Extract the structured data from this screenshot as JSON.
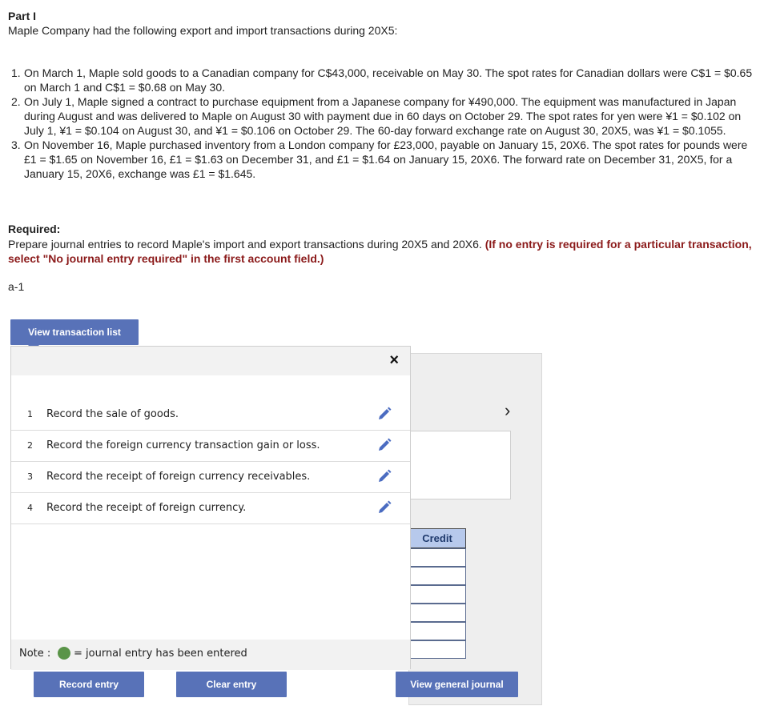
{
  "part_title": "Part I",
  "intro": "Maple Company had the following export and import transactions during 20X5:",
  "items": [
    {
      "num": "1.",
      "text": "On March 1, Maple sold goods to a Canadian company for C$43,000, receivable on May 30. The spot rates for Canadian dollars were C$1 = $0.65 on March 1 and C$1 = $0.68 on May 30."
    },
    {
      "num": "2.",
      "text": "On July 1, Maple signed a contract to purchase equipment from a Japanese company for ¥490,000. The equipment was manufactured in Japan during August and was delivered to Maple on August 30 with payment due in 60 days on October 29. The spot rates for yen were ¥1 = $0.102 on July 1, ¥1 = $0.104 on August 30, and ¥1 = $0.106 on October 29. The 60-day forward exchange rate on August 30, 20X5, was ¥1 = $0.1055."
    },
    {
      "num": "3.",
      "text": "On November 16, Maple purchased inventory from a London company for £23,000, payable on January 15, 20X6. The spot rates for pounds were £1 = $1.65 on November 16, £1 = $1.63 on December 31, and £1 = $1.64 on January 15, 20X6. The forward rate on December 31, 20X5, for a January 15, 20X6, exchange was £1 = $1.645."
    }
  ],
  "required": {
    "title": "Required:",
    "text": "Prepare journal entries to record Maple's import and export transactions during 20X5 and 20X6.",
    "note": "(If no entry is required for a particular transaction, select \"No journal entry required\" in the first account field.)"
  },
  "section_label": "a-1",
  "buttons": {
    "view_transaction_list": "View transaction list",
    "record_entry": "Record entry",
    "clear_entry": "Clear entry",
    "view_general_journal": "View general journal"
  },
  "popup": {
    "close_icon": "×",
    "transactions": [
      {
        "num": "1",
        "desc": "Record the sale of goods."
      },
      {
        "num": "2",
        "desc": "Record the foreign currency transaction gain or loss."
      },
      {
        "num": "3",
        "desc": "Record the receipt of foreign currency receivables."
      },
      {
        "num": "4",
        "desc": "Record the receipt of foreign currency."
      }
    ],
    "note_label": "Note :",
    "note_text": "= journal entry has been entered"
  },
  "background": {
    "next_icon": "›",
    "credit_header": "Credit"
  },
  "colors": {
    "button": "#5872b8",
    "required_note": "#8b1a1a",
    "entered_dot": "#5a9448",
    "credit_header": "#b7c9ec",
    "pencil": "#4b6cc1"
  }
}
